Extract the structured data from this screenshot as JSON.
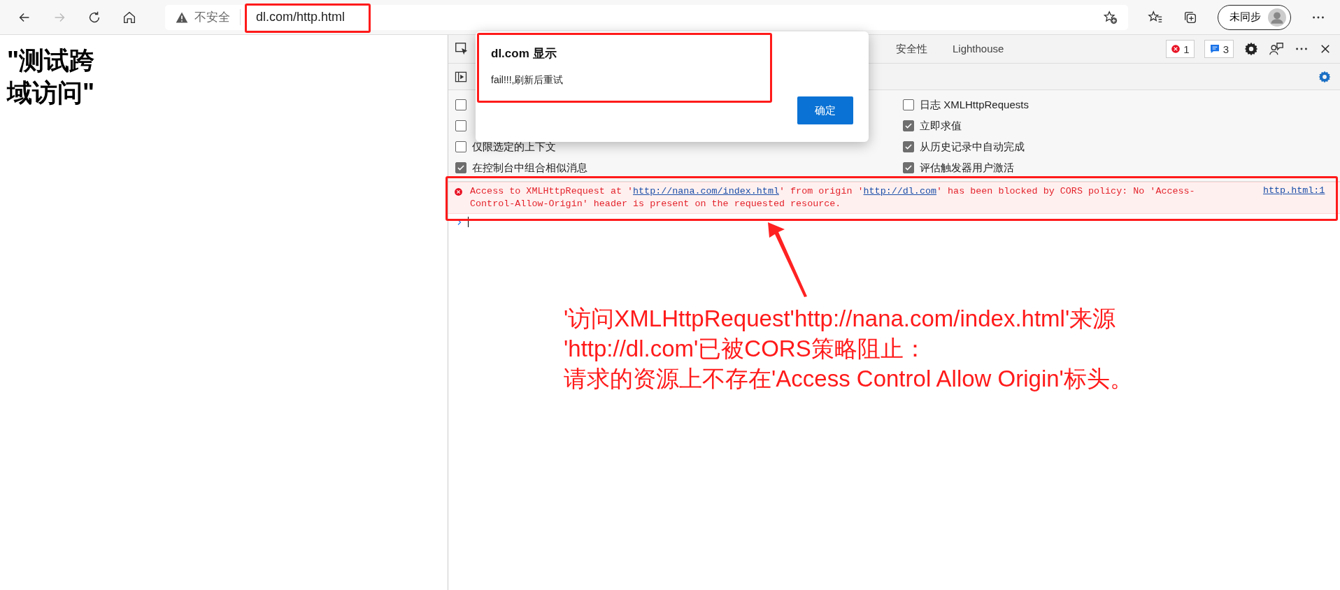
{
  "browser": {
    "security_label": "不安全",
    "url": "dl.com/http.html",
    "profile_label": "未同步"
  },
  "page": {
    "heading": "\"测试跨域访问\""
  },
  "devtools": {
    "tabs": [
      {
        "label": "安全性",
        "selected": false
      },
      {
        "label": "Lighthouse",
        "selected": false
      }
    ],
    "error_count": "1",
    "message_count": "3",
    "options_left": [
      {
        "checked": false
      },
      {
        "checked": false
      },
      {
        "label": "仅限选定的上下文",
        "checked": false
      },
      {
        "label": "在控制台中组合相似消息",
        "checked": true
      }
    ],
    "options_right": [
      {
        "label": "日志 XMLHttpRequests",
        "checked": false
      },
      {
        "label": "立即求值",
        "checked": true
      },
      {
        "label": "从历史记录中自动完成",
        "checked": true
      },
      {
        "label": "评估触发器用户激活",
        "checked": true
      }
    ],
    "error": {
      "parts": [
        {
          "kind": "text",
          "text": "Access to XMLHttpRequest at '"
        },
        {
          "kind": "link",
          "text": "http://nana.com/index.html"
        },
        {
          "kind": "text",
          "text": "' from origin '"
        },
        {
          "kind": "link",
          "text": "http://dl.com"
        },
        {
          "kind": "text",
          "text": "' has been blocked by CORS policy: No 'Access-Control-Allow-Origin' header is present on the requested resource."
        }
      ],
      "source": "http.html:1"
    }
  },
  "dialog": {
    "title": "dl.com 显示",
    "message": "fail!!!,刷新后重试",
    "button": "确定"
  },
  "annotation": {
    "lines": [
      "'访问XMLHttpRequest'http://nana.com/index.html'来源",
      "'http://dl.com'已被CORS策略阻止：",
      "请求的资源上不存在'Access Control Allow Origin'标头。"
    ]
  }
}
